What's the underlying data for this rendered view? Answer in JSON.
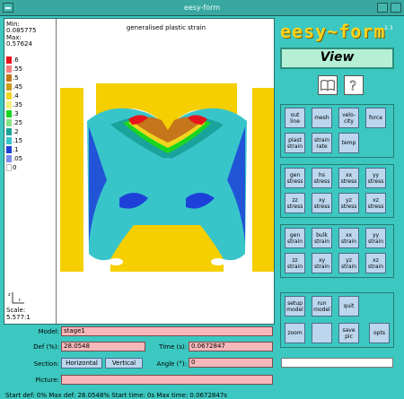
{
  "window": {
    "title": "eesy-form"
  },
  "legend": {
    "min_label": "Min:",
    "min_value": "0.085775",
    "max_label": "Max:",
    "max_value": "0.57624",
    "levels": [
      {
        "label": ".6",
        "color": "#e8141b"
      },
      {
        "label": ".55",
        "color": "#f77f80"
      },
      {
        "label": ".5",
        "color": "#c6761a"
      },
      {
        "label": ".45",
        "color": "#cc9a1a"
      },
      {
        "label": ".4",
        "color": "#f2d51e"
      },
      {
        "label": ".35",
        "color": "#f5f27b"
      },
      {
        "label": ".3",
        "color": "#1ad61f"
      },
      {
        "label": ".25",
        "color": "#84e586"
      },
      {
        "label": ".2",
        "color": "#1aa39c"
      },
      {
        "label": ".15",
        "color": "#38c5ca"
      },
      {
        "label": ".1",
        "color": "#1d40d8"
      },
      {
        "label": ".05",
        "color": "#7d8ef0"
      },
      {
        "label": "0",
        "color": "#ffffff"
      }
    ],
    "scale_axis_z": "z",
    "scale_axis_r": "r",
    "scale_label": "Scale:",
    "scale_value": "5.577:1"
  },
  "plot": {
    "title": "generalised plastic strain"
  },
  "controls": {
    "model_label": "Model:",
    "model_value": "stage1",
    "def_label": "Def (%):",
    "def_value": "28.0548",
    "time_label": "Time (s):",
    "time_value": "0.0672847",
    "section_label": "Section:",
    "horizontal_label": "Horizontal",
    "vertical_label": "Vertical",
    "angle_label": "Angle (°):",
    "angle_value": "0",
    "picture_label": "Picture:",
    "picture_value": "",
    "status": "Start def: 0%    Max def: 28.0548%    Start time: 0s    Max time: 0.0672847s"
  },
  "panel": {
    "logo": "eesy~form",
    "version": "2.3",
    "view_label": "View",
    "group1": [
      "out line",
      "mesh",
      "velo- city",
      "force",
      "plast strain",
      "strain rate",
      "temp"
    ],
    "group2": [
      "gen stress",
      "hs stress",
      "xx stress",
      "yy stress",
      "zz stress",
      "xy stress",
      "yz stress",
      "xz stress"
    ],
    "group3": [
      "gen strain",
      "bulk strain",
      "xx strain",
      "yy strain",
      "zz strain",
      "xy strain",
      "yz strain",
      "xz strain"
    ],
    "group4": [
      "setup model",
      "run model",
      "quit",
      "zoom",
      "",
      "save pic",
      "opts"
    ],
    "blank_field": ""
  },
  "colors": {
    "background": "#3cc8c0",
    "die": "#f5cf00",
    "button": "#bcd6ee",
    "field": "#f7b8ba"
  }
}
